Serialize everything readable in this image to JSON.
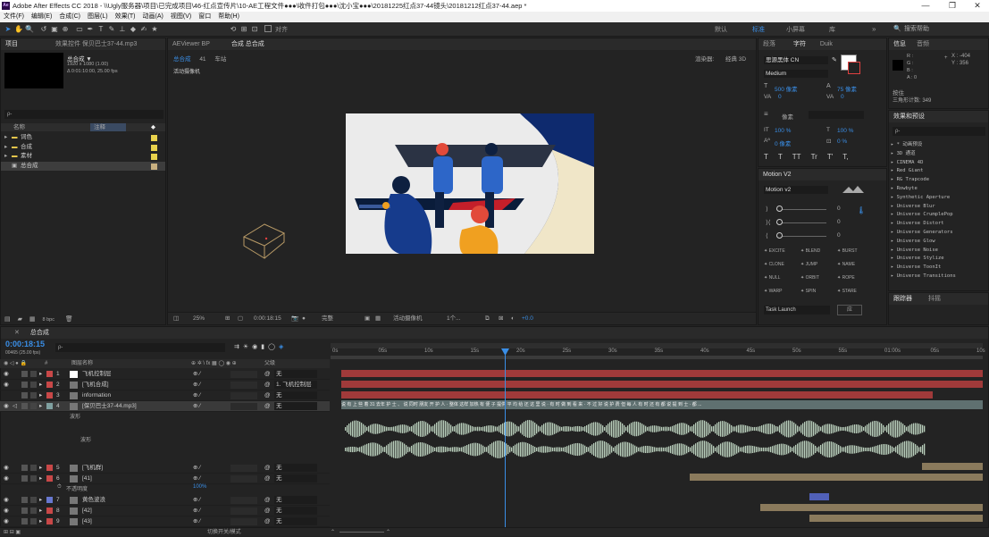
{
  "window": {
    "title": "Adobe After Effects CC 2018 - \\\\Ugly服务器\\项目\\已完成项目\\46-红点宣传片\\10-AE工程文件●●●\\收件打包●●●\\沈小宝●●●\\20181225红点37-44镜头\\20181212红点37-44.aep *",
    "app_icon": "Ae",
    "minimize": "—",
    "restore": "❐",
    "close": "✕"
  },
  "menu": [
    "文件(F)",
    "编辑(E)",
    "合成(C)",
    "图层(L)",
    "效果(T)",
    "动画(A)",
    "视图(V)",
    "窗口",
    "帮助(H)"
  ],
  "toolbar": {
    "align_label": "对齐",
    "workspaces": [
      "默认",
      "标准",
      "小屏幕",
      "库"
    ],
    "active_workspace": "标准",
    "search_placeholder": "搜索帮助"
  },
  "project": {
    "tabs": [
      "项目",
      "效果控件 保贝巴士37-44.mp3"
    ],
    "comp_name": "总合成 ▼",
    "comp_info": [
      "1920 x 1080 (1.00)",
      "Δ 0:01:10:00, 25.00 fps"
    ],
    "search_placeholder": "ρ-",
    "headers": [
      "名称",
      "注释"
    ],
    "items": [
      {
        "name": "词色",
        "color": "#e8d24c"
      },
      {
        "name": "合成",
        "color": "#e8d24c"
      },
      {
        "name": "素材",
        "color": "#e8d24c"
      },
      {
        "name": "总合成",
        "color": "#c8b080"
      }
    ],
    "footer_bpc": "8 bpc"
  },
  "aeviewer": {
    "tab": "AEViewer BP"
  },
  "composition": {
    "tab": "合成 总合成",
    "breadcrumb": [
      "总合成",
      "41",
      "车站"
    ],
    "renderer_label": "渲染器:",
    "renderer_value": "经典 3D",
    "active_camera": "活动摄像机",
    "zoom": "25%",
    "timecode": "0:00:18:15",
    "resolution": "完整",
    "view_camera": "活动摄像机",
    "views": "1个...",
    "exposure": "+0.0"
  },
  "paragraph": {
    "tabs": [
      "段落",
      "字符",
      "Duik"
    ],
    "font_family": "思源黑体 CN",
    "font_style": "Medium",
    "font_size": "500 像素",
    "leading": "75 像素",
    "kerning": "0",
    "tracking": "0",
    "stroke_unit": "像素",
    "vscale": "100 %",
    "hscale": "100 %",
    "baseline": "0 像素",
    "tsume": "0 %",
    "text_buttons": [
      "T",
      "T",
      "TT",
      "Tr",
      "T'",
      "T,"
    ]
  },
  "motion": {
    "tab": "Motion V2",
    "version": "Motion v2",
    "values": [
      "0",
      "0",
      "0"
    ],
    "buttons": [
      "EXCITE",
      "BLEND",
      "BURST",
      "CLONE",
      "JUMP",
      "NAME",
      "NULL",
      "ORBIT",
      "ROPE",
      "WARP",
      "SPIN",
      "STARE"
    ],
    "task_launch": "Task Launch",
    "apply": "应"
  },
  "info": {
    "tabs": [
      "信息",
      "音频"
    ],
    "rgba": [
      "R :",
      "G :",
      "B :",
      "A : 0"
    ],
    "x": "X : -404",
    "y": "Y : 356",
    "status_title": "按住",
    "status_detail": "三角形计数: 349"
  },
  "effects": {
    "tab": "效果和预设",
    "search_placeholder": "ρ-",
    "items": [
      "* 动画预设",
      "3D 通道",
      "CINEMA 4D",
      "Red Giant",
      "RG Trapcode",
      "Rowbyte",
      "Synthetic Aperture",
      "Universe Blur",
      "Universe CrumplePop",
      "Universe Distort",
      "Universe Generators",
      "Universe Glow",
      "Universe Noise",
      "Universe Stylize",
      "Universe ToonIt",
      "Universe Transitions"
    ]
  },
  "tracker": {
    "tabs": [
      "跟踪器",
      "抖摇"
    ]
  },
  "timeline": {
    "tab": "总合成",
    "timecode": "0:00:18:15",
    "timecode_sub": "00465 (25.00 fps)",
    "search_placeholder": "ρ-",
    "headers": {
      "num": "#",
      "name": "图层名称",
      "parent": "父级"
    },
    "ticks": [
      "0s",
      "05s",
      "10s",
      "15s",
      "20s",
      "25s",
      "30s",
      "35s",
      "40s",
      "45s",
      "50s",
      "55s",
      "01:00s",
      "05s",
      "10s"
    ],
    "layers": [
      {
        "num": "1",
        "name": "飞机控制层",
        "parent": "无",
        "color": "#c84848"
      },
      {
        "num": "2",
        "name": "[飞机合成]",
        "parent": "1. 飞机控制层",
        "color": "#c84848"
      },
      {
        "num": "3",
        "name": "information",
        "parent": "无",
        "color": "#c84848"
      },
      {
        "num": "4",
        "name": "[保贝巴士37-44.mp3]",
        "parent": "无",
        "color": "#7fa0a0"
      },
      {
        "num": "5",
        "name": "[飞机群]",
        "parent": "无",
        "color": "#c84848"
      },
      {
        "num": "6",
        "name": "[41]",
        "parent": "无",
        "color": "#c84848"
      },
      {
        "num": "7",
        "name": "黄色波浪",
        "parent": "无",
        "color": "#6878d0"
      },
      {
        "num": "8",
        "name": "[42]",
        "parent": "无",
        "color": "#c84848"
      },
      {
        "num": "9",
        "name": "[43]",
        "parent": "无",
        "color": "#c84848"
      }
    ],
    "waveform_label": "波形",
    "waveform_sub": "波形",
    "opacity_label": "不透明度",
    "opacity_value": "100%",
    "footer_toggle": "切换开关/模式",
    "subtitle_strip": "说 有 上 些 着 31 去年 护 士 、 说 同时 朋友 开 护 人 · 整体 这样 加热 有 便 子 提供 平 均 给 还 这 里 说 · 有 时 做 到 看 来 · 不 过 好 说 护 费 但 每 人 有 时 还 有 都 说 提 到 士 · 都 ..."
  }
}
